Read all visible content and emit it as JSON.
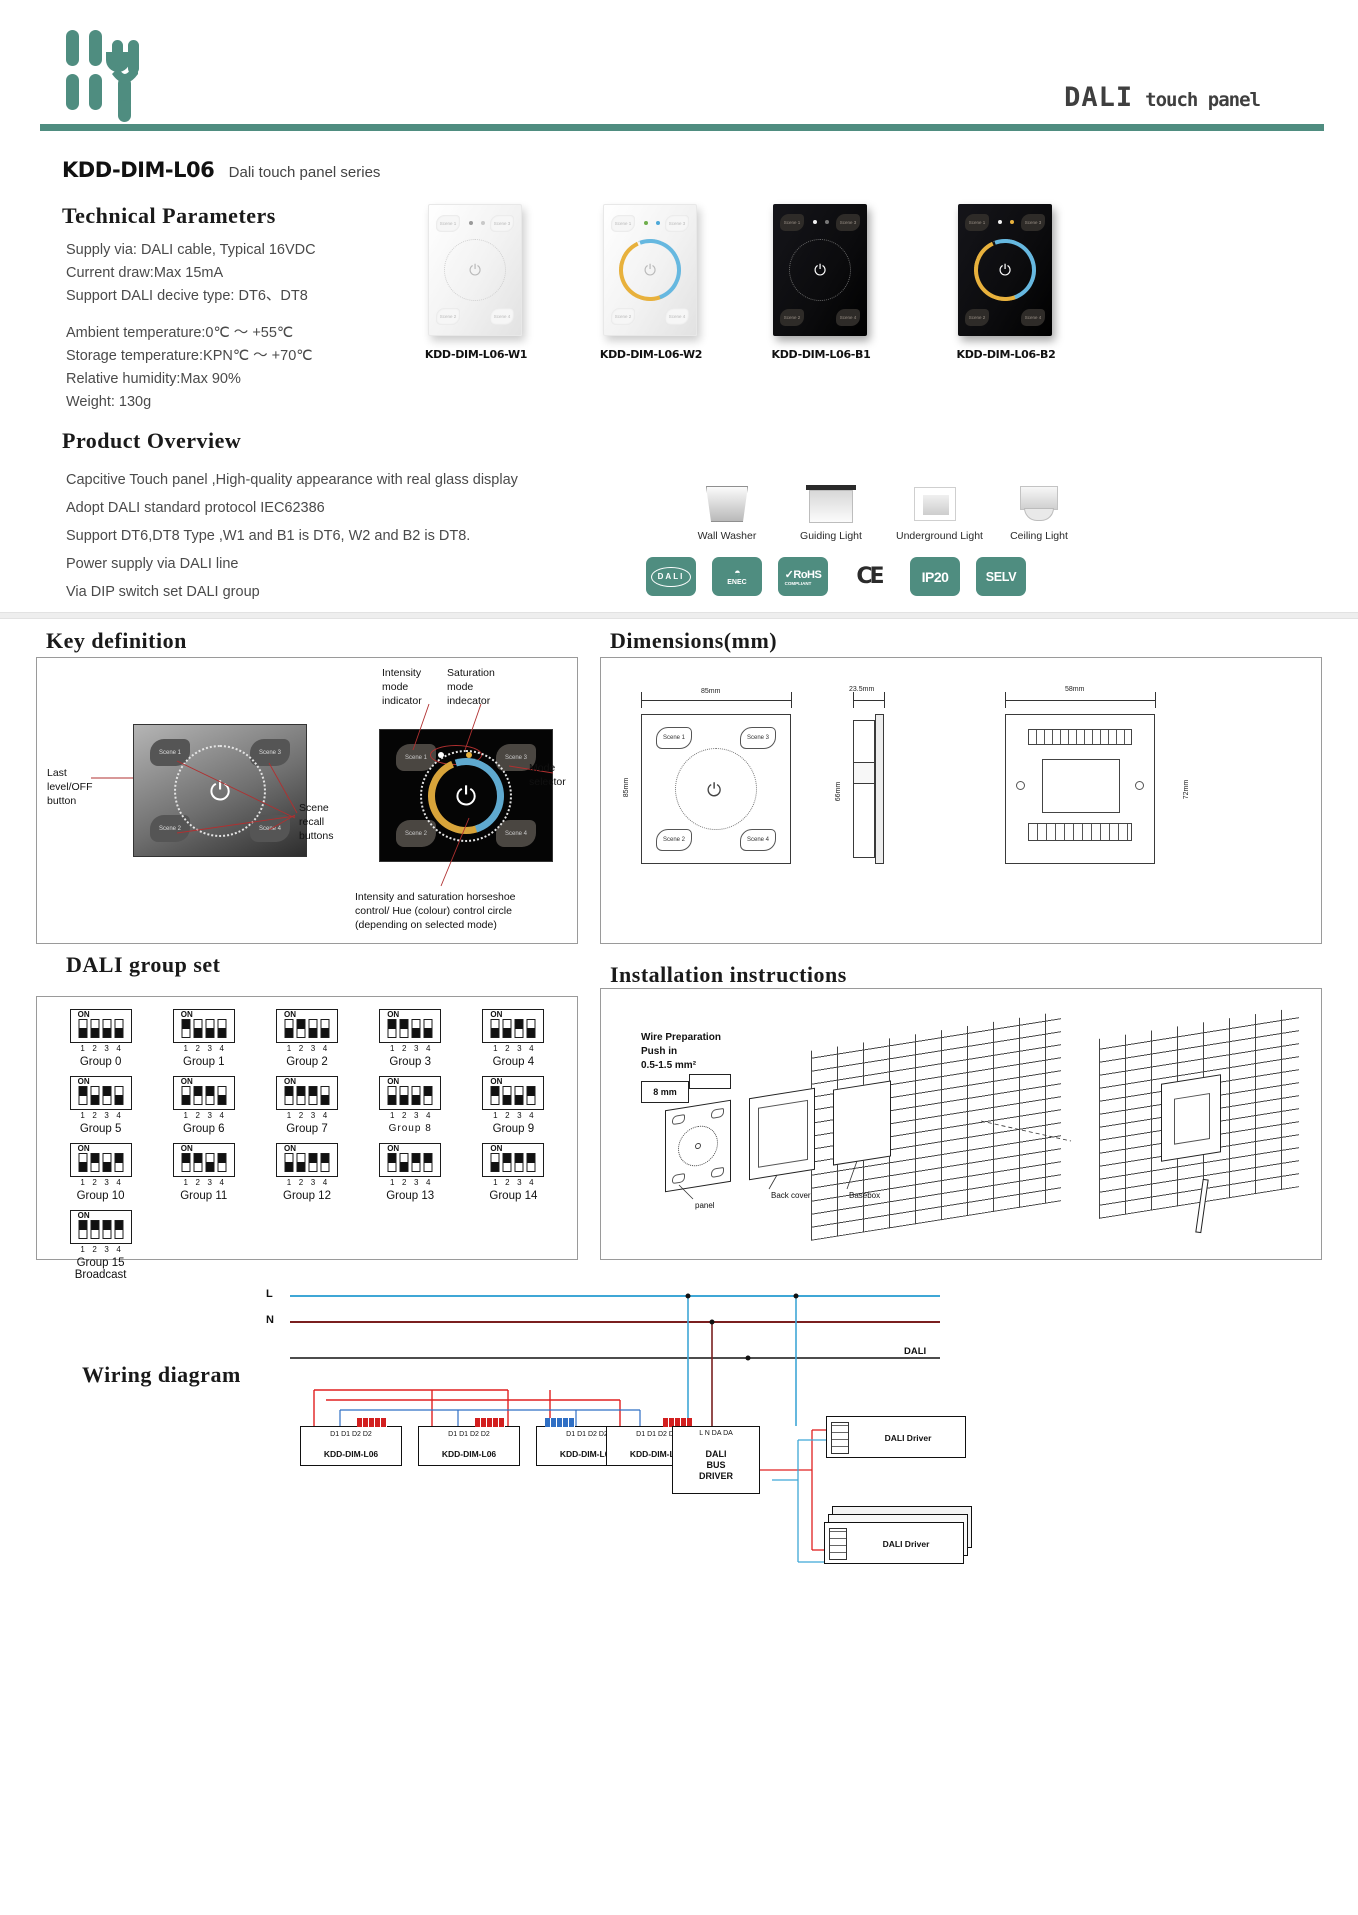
{
  "header": {
    "title_main": "DALI",
    "title_sub": "touch panel",
    "logo_name": "kdd-logo",
    "accent_color": "#4f8d80"
  },
  "model": {
    "code": "KDD-DIM-L06",
    "series": "Dali touch panel series"
  },
  "technical": {
    "heading": "Technical Parameters",
    "params": [
      "Supply via: DALI cable, Typical 16VDC",
      "Current draw:Max 15mA",
      "Support DALI decive type: DT6、DT8"
    ],
    "params2": [
      "Ambient temperature:0℃ ～ +55℃",
      "Storage temperature:KPN℃ ～ +70℃",
      "Relative humidity:Max 90%",
      "Weight: 130g"
    ]
  },
  "products": [
    {
      "label": "KDD-DIM-L06-W1",
      "finish": "white",
      "mode": "dt6"
    },
    {
      "label": "KDD-DIM-L06-W2",
      "finish": "white",
      "mode": "dt8"
    },
    {
      "label": "KDD-DIM-L06-B1",
      "finish": "black",
      "mode": "dt6"
    },
    {
      "label": "KDD-DIM-L06-B2",
      "finish": "black",
      "mode": "dt8"
    }
  ],
  "overview": {
    "heading": "Product Overview",
    "lines": [
      "Capcitive Touch panel ,High-quality appearance with real glass display",
      "Adopt DALI standard protocol IEC62386",
      "Support DT6,DT8 Type ,W1 and B1 is DT6, W2 and B2 is DT8.",
      "Power supply via DALI line",
      "Via DIP switch set DALI group"
    ]
  },
  "applications": [
    {
      "caption": "Wall Washer",
      "icon": "wall-washer-icon"
    },
    {
      "caption": "Guiding Light",
      "icon": "guiding-light-icon"
    },
    {
      "caption": "Underground Light",
      "icon": "underground-light-icon"
    },
    {
      "caption": "Ceiling Light",
      "icon": "ceiling-light-icon"
    }
  ],
  "certifications": [
    {
      "name": "DALI",
      "icon": "dali-badge"
    },
    {
      "name": "ENEC",
      "icon": "enec-badge"
    },
    {
      "name": "RoHS",
      "sub": "COMPLIANT",
      "icon": "rohs-badge"
    },
    {
      "name": "CE",
      "icon": "ce-badge"
    },
    {
      "name": "IP20",
      "icon": "ip20-badge"
    },
    {
      "name": "SELV",
      "icon": "selv-badge"
    }
  ],
  "key_definition": {
    "heading": "Key definition",
    "notes": {
      "last_level": "Last\nlevel/OFF\nbutton",
      "last_level_l1": "Last",
      "last_level_l2": "level/OFF",
      "last_level_l3": "button",
      "scene_recall_l1": "Scene",
      "scene_recall_l2": "recall",
      "scene_recall_l3": "buttons",
      "intensity_l1": "Intensity",
      "intensity_l2": "mode",
      "intensity_l3": "indicator",
      "saturation_l1": "Saturation",
      "saturation_l2": "mode",
      "saturation_l3": "indecator",
      "mode_selector_l1": "Mode",
      "mode_selector_l2": "selector",
      "horseshoe_l1": "Intensity and saturation horseshoe",
      "horseshoe_l2": "control/ Hue (colour) control circle",
      "horseshoe_l3": "(depending on selected mode)"
    },
    "scene_labels": [
      "Scene 1",
      "Scene 2",
      "Scene 3",
      "Scene 4"
    ]
  },
  "dimensions": {
    "heading": "Dimensions(mm)",
    "front_width": "85mm",
    "front_height": "85mm",
    "depth": "23.5mm",
    "side_height": "66mm",
    "back_width": "58mm",
    "back_height": "72mm"
  },
  "dali_group": {
    "heading": "DALI group set",
    "dip_numbers": [
      "1",
      "2",
      "3",
      "4"
    ],
    "dip_on_label": "ON",
    "groups": [
      {
        "name": "Group 0",
        "switches": [
          "down",
          "down",
          "down",
          "down"
        ]
      },
      {
        "name": "Group 1",
        "switches": [
          "up",
          "down",
          "down",
          "down"
        ]
      },
      {
        "name": "Group 2",
        "switches": [
          "down",
          "up",
          "down",
          "down"
        ]
      },
      {
        "name": "Group 3",
        "switches": [
          "up",
          "up",
          "down",
          "down"
        ]
      },
      {
        "name": "Group 4",
        "switches": [
          "down",
          "down",
          "up",
          "down"
        ]
      },
      {
        "name": "Group 5",
        "switches": [
          "up",
          "down",
          "up",
          "down"
        ]
      },
      {
        "name": "Group 6",
        "switches": [
          "down",
          "up",
          "up",
          "down"
        ]
      },
      {
        "name": "Group 7",
        "switches": [
          "up",
          "up",
          "up",
          "down"
        ]
      },
      {
        "name": "Group  8",
        "switches": [
          "down",
          "down",
          "down",
          "up"
        ]
      },
      {
        "name": "Group 9",
        "switches": [
          "up",
          "down",
          "down",
          "up"
        ]
      },
      {
        "name": "Group 10",
        "switches": [
          "down",
          "up",
          "down",
          "up"
        ]
      },
      {
        "name": "Group 11",
        "switches": [
          "up",
          "up",
          "down",
          "up"
        ]
      },
      {
        "name": "Group 12",
        "switches": [
          "down",
          "down",
          "up",
          "up"
        ]
      },
      {
        "name": "Group 13",
        "switches": [
          "up",
          "down",
          "up",
          "up"
        ]
      },
      {
        "name": "Group 14",
        "switches": [
          "down",
          "up",
          "up",
          "up"
        ]
      },
      {
        "name": "Group 15",
        "sub": "Broadcast",
        "switches": [
          "up",
          "up",
          "up",
          "up"
        ]
      }
    ]
  },
  "installation": {
    "heading": "Installation instructions",
    "note_l1": "Wire Preparation",
    "note_l2": "Push in",
    "note_l3": "0.5-1.5 mm²",
    "strip_len": "8 mm",
    "leads": [
      "panel",
      "Back cover",
      "Basebox"
    ]
  },
  "wiring": {
    "heading": "Wiring diagram",
    "rail_l": "L",
    "rail_n": "N",
    "dali_rail": "DALI",
    "panels": [
      {
        "label": "KDD-DIM-L06",
        "terminals": "D1 D1 D2 D2"
      },
      {
        "label": "KDD-DIM-L06",
        "terminals": "D1 D1 D2 D2"
      },
      {
        "label": "KDD-DIM-L06",
        "terminals": "D1 D1 D2 D2"
      },
      {
        "label": "KDD-DIM-L06",
        "terminals": "D1 D1 D2 D2"
      }
    ],
    "bus_driver": {
      "l1": "DALI",
      "l2": "BUS",
      "l3": "DRIVER",
      "terminals": "L N   DA DA"
    },
    "drivers": [
      {
        "label": "DALI Driver"
      },
      {
        "label": "DALI Driver"
      }
    ]
  }
}
